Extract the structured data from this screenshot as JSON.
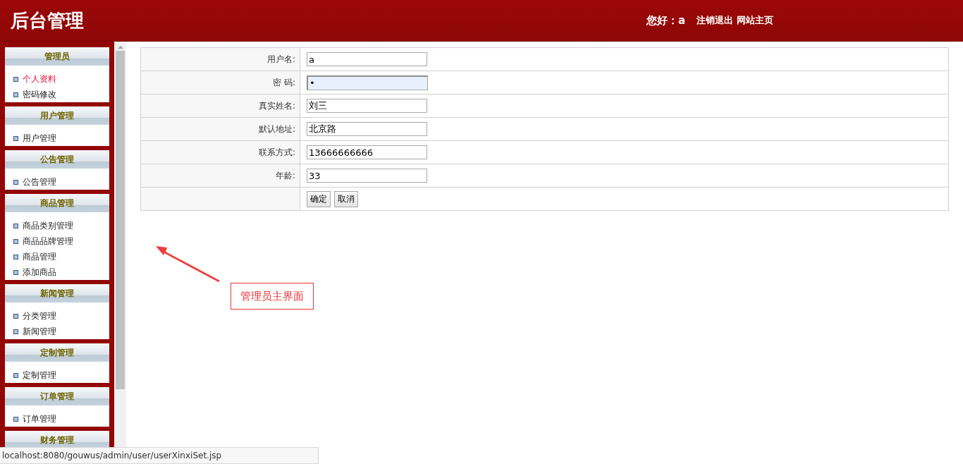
{
  "header": {
    "title": "后台管理",
    "greeting": "您好：a",
    "links": [
      "注销退出",
      "网站主页"
    ]
  },
  "sidebar": {
    "groups": [
      {
        "title": "管理员",
        "items": [
          {
            "label": "个人资料",
            "selected": true
          },
          {
            "label": "密码修改",
            "selected": false
          }
        ]
      },
      {
        "title": "用户管理",
        "items": [
          {
            "label": "用户管理",
            "selected": false
          }
        ]
      },
      {
        "title": "公告管理",
        "items": [
          {
            "label": "公告管理",
            "selected": false
          }
        ]
      },
      {
        "title": "商品管理",
        "items": [
          {
            "label": "商品类别管理",
            "selected": false
          },
          {
            "label": "商品品牌管理",
            "selected": false
          },
          {
            "label": "商品管理",
            "selected": false
          },
          {
            "label": "添加商品",
            "selected": false
          }
        ]
      },
      {
        "title": "新闻管理",
        "items": [
          {
            "label": "分类管理",
            "selected": false
          },
          {
            "label": "新闻管理",
            "selected": false
          }
        ]
      },
      {
        "title": "定制管理",
        "items": [
          {
            "label": "定制管理",
            "selected": false
          }
        ]
      },
      {
        "title": "订单管理",
        "items": [
          {
            "label": "订单管理",
            "selected": false
          }
        ]
      },
      {
        "title": "财务管理"
      }
    ]
  },
  "form": {
    "rows": [
      {
        "label": "用户名:",
        "value": "a",
        "focused": false
      },
      {
        "label": "密 码:",
        "value": "•",
        "focused": true
      },
      {
        "label": "真实姓名:",
        "value": "刘三",
        "focused": false
      },
      {
        "label": "默认地址:",
        "value": "北京路",
        "focused": false
      },
      {
        "label": "联系方式:",
        "value": "13666666666",
        "focused": false
      },
      {
        "label": "年龄:",
        "value": "33",
        "focused": false
      }
    ],
    "buttons": [
      "确定",
      "取消"
    ]
  },
  "annotation": {
    "text": "管理员主界面"
  },
  "status_bar": {
    "url": "localhost:8080/gouwus/admin/user/userXinxiSet.jsp"
  }
}
